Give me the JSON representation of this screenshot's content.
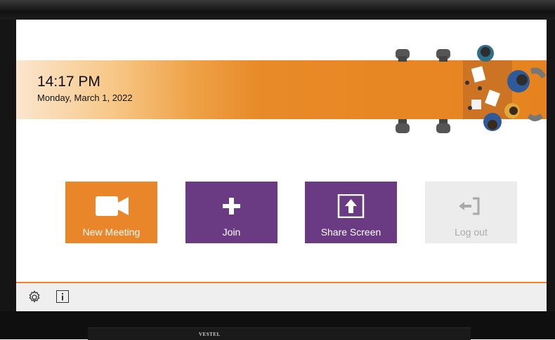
{
  "clock": {
    "time": "14:17 PM",
    "date": "Monday, March 1, 2022"
  },
  "tiles": [
    {
      "label": "New Meeting",
      "icon": "video-camera-icon",
      "color": "#e9862a"
    },
    {
      "label": "Join",
      "icon": "plus-icon",
      "color": "#6a3a82"
    },
    {
      "label": "Share Screen",
      "icon": "share-upload-icon",
      "color": "#6a3a82"
    },
    {
      "label": "Log out",
      "icon": "logout-icon",
      "color": "#ececec",
      "disabled": true
    }
  ],
  "footer": {
    "settings_icon": "gear-icon",
    "info_icon": "info-icon"
  },
  "device": {
    "brand": "VESTEL"
  },
  "colors": {
    "accent": "#e9862a",
    "purple": "#6a3a82",
    "footer_bg": "#efefef"
  }
}
